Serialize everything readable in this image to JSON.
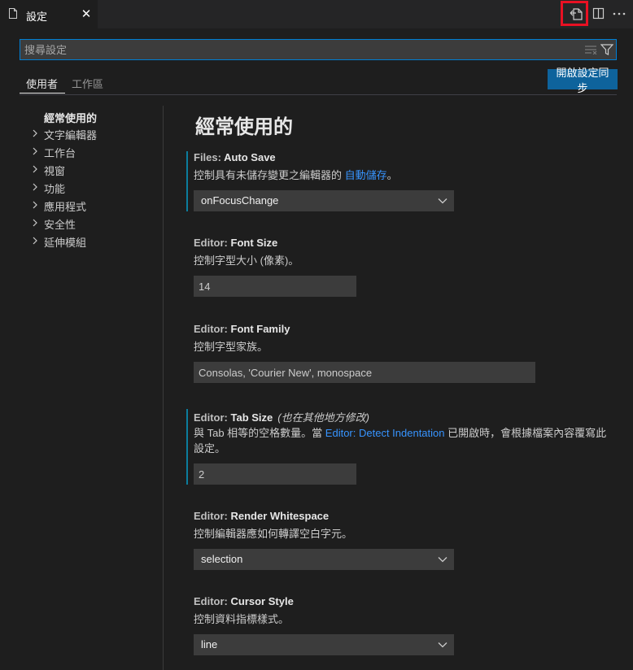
{
  "tab": {
    "title": "設定",
    "close": "✕"
  },
  "search": {
    "placeholder": "搜尋設定",
    "value": ""
  },
  "scopes": {
    "user": "使用者",
    "workspace": "工作區"
  },
  "sync_button": "開啟設定同步",
  "toc": {
    "title": "經常使用的",
    "items": [
      "文字編輯器",
      "工作台",
      "視窗",
      "功能",
      "應用程式",
      "安全性",
      "延伸模組"
    ]
  },
  "main": {
    "section_title": "經常使用的",
    "settings": [
      {
        "category": "Files: ",
        "key": "Auto Save",
        "desc_before": "控制具有未儲存變更之編輯器的 ",
        "desc_link": "自動儲存",
        "desc_after": "。",
        "value": "onFocusChange"
      },
      {
        "category": "Editor: ",
        "key": "Font Size",
        "desc": "控制字型大小 (像素)。",
        "value": "14"
      },
      {
        "category": "Editor: ",
        "key": "Font Family",
        "desc": "控制字型家族。",
        "value": "Consolas, 'Courier New', monospace"
      },
      {
        "category": "Editor: ",
        "key": "Tab Size",
        "note": "(也在其他地方修改)",
        "desc_before": "與 Tab 相等的空格數量。當 ",
        "desc_link": "Editor: Detect Indentation",
        "desc_after": " 已開啟時，會根據檔案內容覆寫此設定。",
        "value": "2"
      },
      {
        "category": "Editor: ",
        "key": "Render Whitespace",
        "desc": "控制編輯器應如何轉譯空白字元。",
        "value": "selection"
      },
      {
        "category": "Editor: ",
        "key": "Cursor Style",
        "desc": "控制資料指標樣式。",
        "value": "line"
      }
    ]
  },
  "colors": {
    "accent": "#007fd4",
    "button": "#0e639c",
    "link": "#3794ff",
    "modified": "#0c7d9d",
    "highlight": "#e81123"
  }
}
